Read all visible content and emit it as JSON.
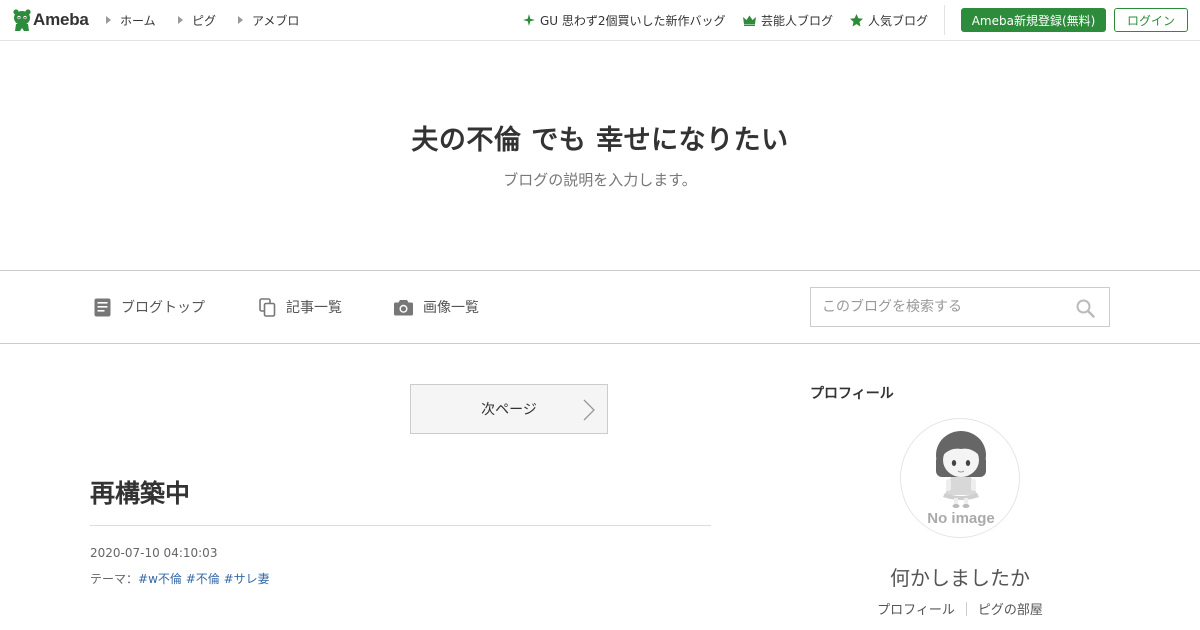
{
  "topbar": {
    "logo_text": "Ameba",
    "breadcrumbs": [
      {
        "label": "ホーム"
      },
      {
        "label": "ピグ"
      },
      {
        "label": "アメブロ"
      }
    ],
    "links": [
      {
        "label": "GU 思わず2個買いした新作バッグ",
        "icon": "sparkle-icon"
      },
      {
        "label": "芸能人ブログ",
        "icon": "crown-icon"
      },
      {
        "label": "人気ブログ",
        "icon": "star-icon"
      }
    ],
    "register_label": "Ameba新規登録(無料)",
    "login_label": "ログイン"
  },
  "header": {
    "title": "夫の不倫 でも 幸せになりたい",
    "description": "ブログの説明を入力します。"
  },
  "nav": {
    "items": [
      {
        "label": "ブログトップ",
        "icon": "document-icon"
      },
      {
        "label": "記事一覧",
        "icon": "copy-icon"
      },
      {
        "label": "画像一覧",
        "icon": "camera-icon"
      }
    ],
    "search_placeholder": "このブログを検索する"
  },
  "main": {
    "next_page_label": "次ページ",
    "post": {
      "title": "再構築中",
      "date": "2020-07-10 04:10:03",
      "theme_label": "テーマ：",
      "tags": [
        "#w不倫",
        "#不倫",
        "#サレ妻"
      ]
    }
  },
  "sidebar": {
    "heading": "プロフィール",
    "avatar_text": "No image",
    "profile_name": "何かしましたか",
    "links": [
      "プロフィール",
      "ピグの部屋"
    ]
  },
  "colors": {
    "brand_green": "#2d8c3c",
    "link_blue": "#3469a8",
    "border": "#cccccc"
  }
}
